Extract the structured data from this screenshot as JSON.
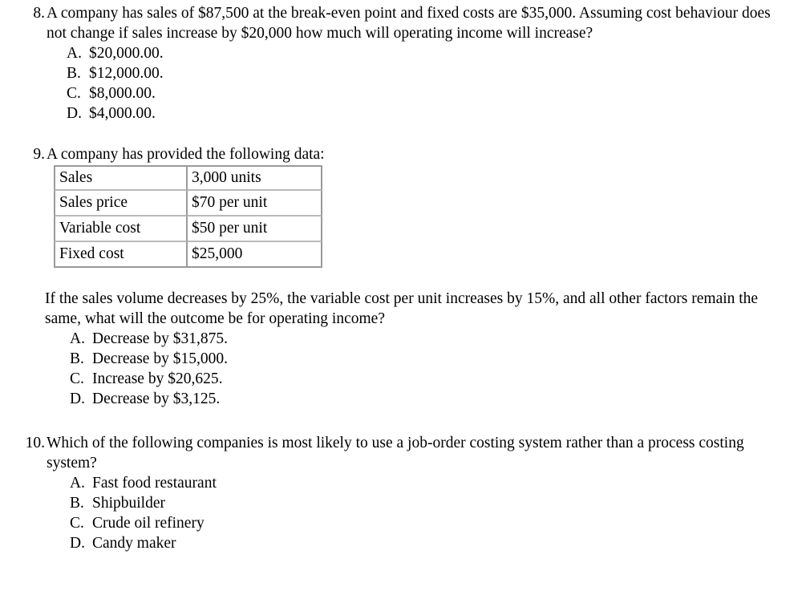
{
  "document": {
    "type": "multiple-choice-exam-page",
    "questions": [
      {
        "number": "8.",
        "text": "A company has sales of $87,500 at the break-even point and fixed costs are $35,000. Assuming cost behaviour does not change if sales increase by $20,000 how much will operating income will increase?",
        "options": [
          {
            "letter": "A.",
            "text": "$20,000.00."
          },
          {
            "letter": "B.",
            "text": "$12,000.00."
          },
          {
            "letter": "C.",
            "text": "$8,000.00."
          },
          {
            "letter": "D.",
            "text": "$4,000.00."
          }
        ]
      },
      {
        "number": "9.",
        "text": "A company has provided the following data:",
        "table": {
          "rows": [
            {
              "label": "Sales",
              "value": "3,000 units"
            },
            {
              "label": "Sales price",
              "value": "$70 per unit"
            },
            {
              "label": "Variable cost",
              "value": "$50 per unit"
            },
            {
              "label": "Fixed cost",
              "value": "$25,000"
            }
          ]
        },
        "sub_paragraph": "If the sales volume decreases by 25%, the variable cost per unit increases by 15%, and all other factors remain the same, what will the outcome be for operating income?",
        "options": [
          {
            "letter": "A.",
            "text": "Decrease by $31,875."
          },
          {
            "letter": "B.",
            "text": "Decrease by $15,000."
          },
          {
            "letter": "C.",
            "text": "Increase by $20,625."
          },
          {
            "letter": "D.",
            "text": "Decrease by $3,125."
          }
        ]
      },
      {
        "number": "10.",
        "text": "Which of the following companies is most likely to use a job-order costing system rather than a process costing system?",
        "options": [
          {
            "letter": "A.",
            "text": "Fast food restaurant"
          },
          {
            "letter": "B.",
            "text": "Shipbuilder"
          },
          {
            "letter": "C.",
            "text": "Crude oil refinery"
          },
          {
            "letter": "D.",
            "text": "Candy maker"
          }
        ]
      }
    ]
  }
}
